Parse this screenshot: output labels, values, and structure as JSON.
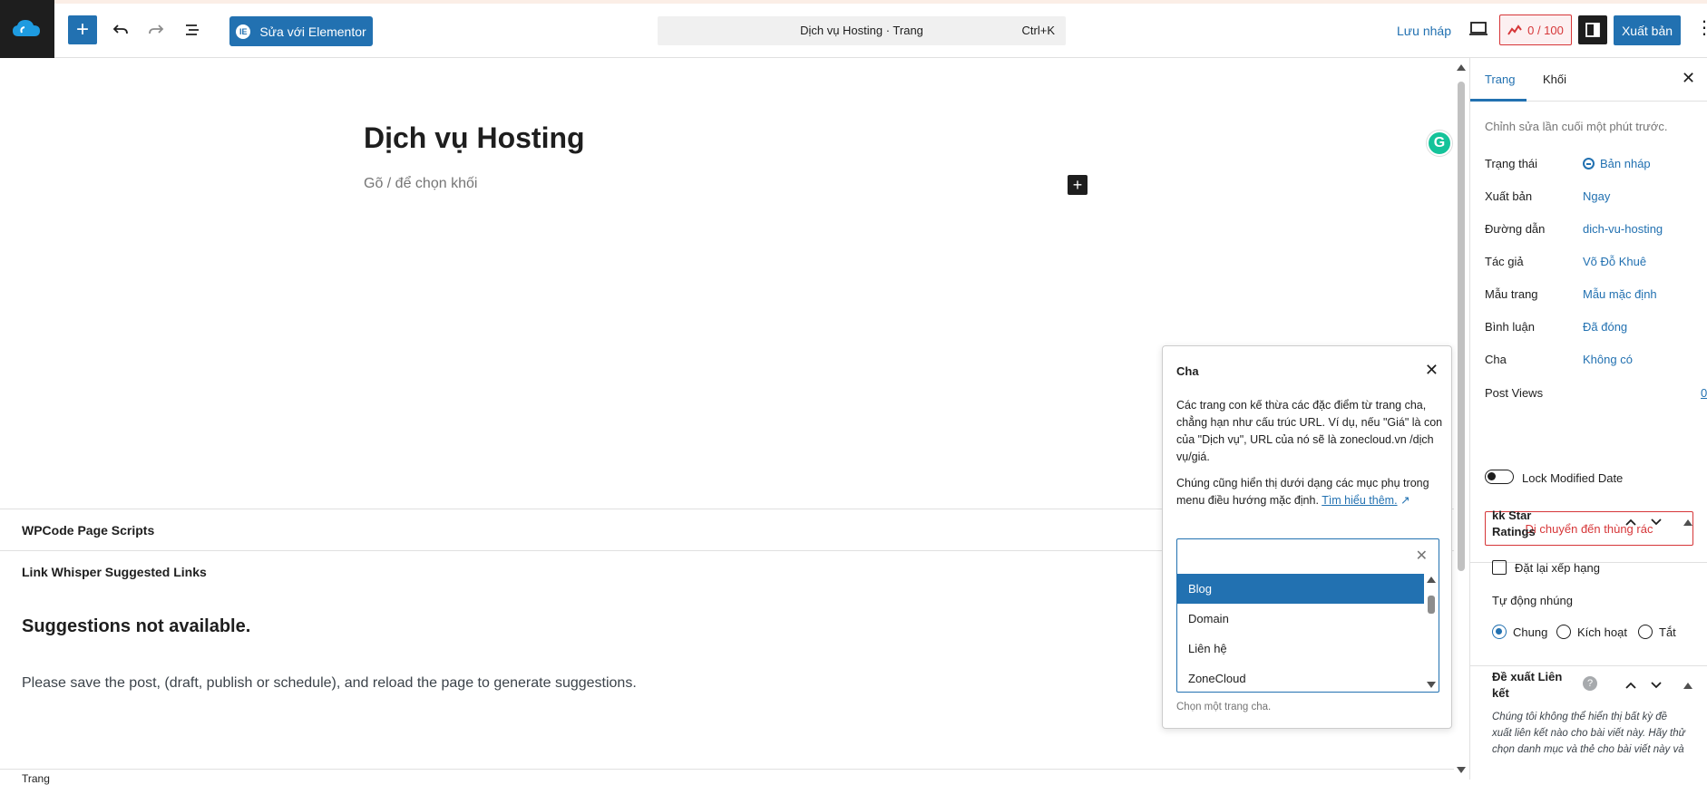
{
  "toolbar": {
    "elementor_label": "Sửa với Elementor",
    "elementor_icon": "IE",
    "command_title": "Dịch vụ Hosting · Trang",
    "command_shortcut": "Ctrl+K",
    "save_draft": "Lưu nháp",
    "score": "0 / 100",
    "publish": "Xuất bản",
    "inserter_icon": "+",
    "icons": [
      "site-logo-icon",
      "plus-icon",
      "undo-icon",
      "redo-icon",
      "list-view-icon",
      "preview-icon",
      "seo-score-icon",
      "settings-icon",
      "options-icon"
    ]
  },
  "editor": {
    "title": "Dịch vụ Hosting",
    "placeholder": "Gõ / để chọn khối",
    "add_block": "+",
    "grammarly": "G"
  },
  "meta": {
    "boxes": [
      "WPCode Page Scripts",
      "Link Whisper Suggested Links"
    ],
    "suggest_title": "Suggestions not available.",
    "suggest_text": "Please save the post, (draft, publish or schedule), and reload the page to generate suggestions.",
    "bottom_label": "Trang"
  },
  "parent_popover": {
    "title": "Cha",
    "paragraph1": "Các trang con kế thừa các đặc điểm từ trang cha, chẳng hạn như cấu trúc URL. Ví dụ, nếu \"Giá\" là con của \"Dịch vụ\", URL của nó sẽ là zonecloud.vn /dịch vụ/giá.",
    "paragraph2": "Chúng cũng hiển thị dưới dạng các mục phụ trong menu điều hướng mặc định.",
    "learn_more": "Tìm hiểu thêm.",
    "learn_more_arrow": "↗",
    "options": [
      "Blog",
      "Domain",
      "Liên hệ",
      "ZoneCloud"
    ],
    "selected": "Blog",
    "hint": "Chọn một trang cha."
  },
  "sidebar": {
    "tabs": [
      "Trang",
      "Khối"
    ],
    "active_tab": "Trang",
    "last_edited": "Chỉnh sửa lần cuối một phút trước.",
    "properties": [
      {
        "label": "Trạng thái",
        "value": "Bản nháp"
      },
      {
        "label": "Xuất bản",
        "value": "Ngay"
      },
      {
        "label": "Đường dẫn",
        "value": "dich-vu-hosting"
      },
      {
        "label": "Tác giả",
        "value": "Võ Đỗ Khuê"
      },
      {
        "label": "Mẫu trang",
        "value": "Mẫu mặc định"
      },
      {
        "label": "Bình luận",
        "value": "Đã đóng"
      },
      {
        "label": "Cha",
        "value": "Không có"
      }
    ],
    "post_views_label": "Post Views",
    "post_views_value": "0",
    "lock_modified": "Lock Modified Date",
    "lock_modified_on": false,
    "trash": "Di chuyển đến thùng rác",
    "kk_title_line1": "kk Star",
    "kk_title_line2": "Ratings",
    "reset_rating": "Đặt lại xếp hạng",
    "auto_embed": "Tự động nhúng",
    "embed_options": [
      "Chung",
      "Kích hoạt",
      "Tắt"
    ],
    "embed_selected": "Chung",
    "link_title_line1": "Đề xuất Liên",
    "link_title_line2": "kết",
    "link_desc": "Chúng tôi không thể hiển thị bất kỳ đề xuất liên kết nào cho bài viết này. Hãy thử chọn danh mục và thẻ cho bài viết này và"
  },
  "colors": {
    "accent": "#2271b1",
    "danger": "#d63638",
    "dark": "#1e1e1e"
  }
}
